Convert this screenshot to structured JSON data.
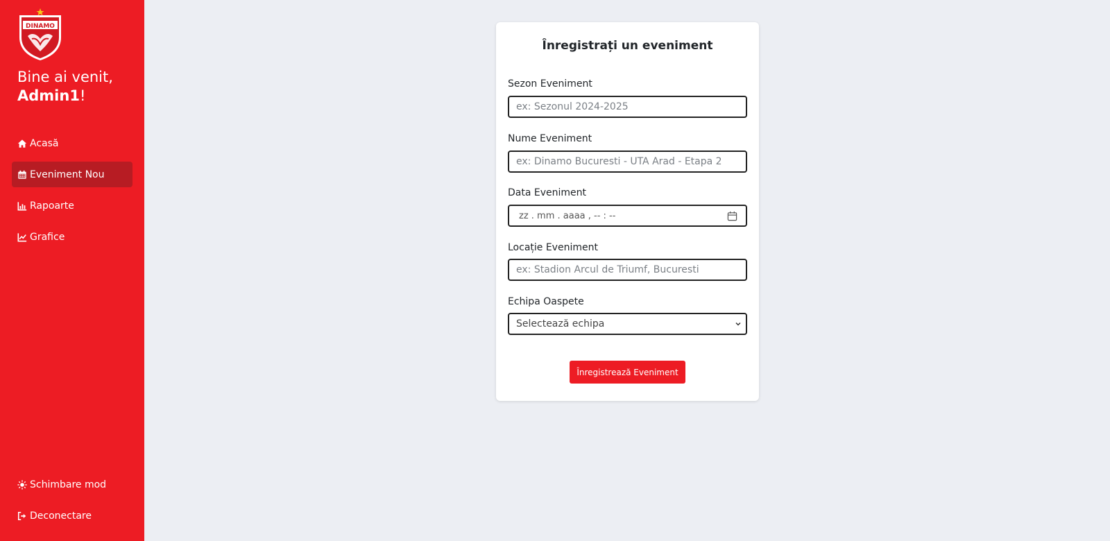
{
  "sidebar": {
    "welcome_text": "Bine ai venit,",
    "username": "Admin1",
    "exclamation": "!",
    "logo_text": "DINAMO",
    "items": [
      {
        "label": "Acasă",
        "icon": "home-icon"
      },
      {
        "label": "Eveniment Nou",
        "icon": "calendar-icon",
        "active": true
      },
      {
        "label": "Rapoarte",
        "icon": "bar-chart-icon"
      },
      {
        "label": "Grafice",
        "icon": "line-chart-icon"
      }
    ],
    "bottom_items": [
      {
        "label": "Schimbare mod",
        "icon": "sun-icon"
      },
      {
        "label": "Deconectare",
        "icon": "logout-icon"
      }
    ]
  },
  "form": {
    "title": "Înregistrați un eveniment",
    "season": {
      "label": "Sezon Eveniment",
      "placeholder": "ex: Sezonul 2024-2025"
    },
    "name": {
      "label": "Nume Eveniment",
      "placeholder": "ex: Dinamo Bucuresti - UTA Arad - Etapa 2"
    },
    "date": {
      "label": "Data Eveniment",
      "placeholder": "zz . mm . aaaa ,  -- : --"
    },
    "location": {
      "label": "Locație Eveniment",
      "placeholder": "ex: Stadion Arcul de Triumf, Bucuresti"
    },
    "team": {
      "label": "Echipa Oaspete",
      "selected": "Selectează echipa"
    },
    "submit_label": "Înregistrează Eveniment"
  },
  "colors": {
    "accent": "#ed1c24",
    "active_nav": "#b71c23",
    "background": "#eceef3"
  }
}
